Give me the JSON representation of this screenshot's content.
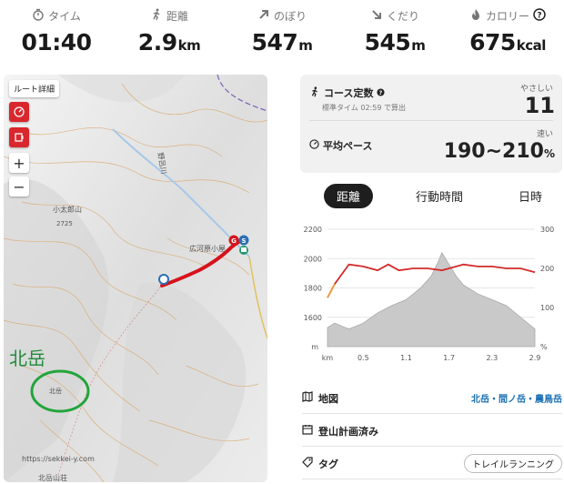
{
  "stats": [
    {
      "icon": "stopwatch-icon",
      "label": "タイム",
      "value": "01:40",
      "unit": ""
    },
    {
      "icon": "hiker-icon",
      "label": "距離",
      "value": "2.9",
      "unit": "km"
    },
    {
      "icon": "arrow-up-right-icon",
      "label": "のぼり",
      "value": "547",
      "unit": "m"
    },
    {
      "icon": "arrow-down-right-icon",
      "label": "くだり",
      "value": "545",
      "unit": "m"
    },
    {
      "icon": "flame-icon",
      "label": "カロリー",
      "value": "675",
      "unit": "kcal"
    }
  ],
  "map": {
    "route_detail_label": "ルート詳細",
    "zoom_in": "+",
    "zoom_out": "−",
    "labels": {
      "hut": "広河原小屋",
      "peak1": "小太郎山",
      "peak1_elev": "2725",
      "kitadake_map": "北岳",
      "kitadake_hut": "北岳山荘",
      "river": "野呂川"
    },
    "annotation": "北岳",
    "copyright": "https://sekkei-y.com",
    "markers": {
      "goal": "G",
      "start": "S",
      "bus": "B"
    }
  },
  "course": {
    "title": "コース定数",
    "standard_time": "標準タイム 02:59 で算出",
    "easy_label": "やさしい",
    "constant": "11",
    "pace_title": "平均ペース",
    "fast_label": "速い",
    "pace_value": "190~210",
    "pace_unit": "%"
  },
  "tabs": [
    {
      "label": "距離",
      "active": true
    },
    {
      "label": "行動時間",
      "active": false
    },
    {
      "label": "日時",
      "active": false
    }
  ],
  "chart_data": {
    "type": "area",
    "x_unit": "km",
    "left_unit": "m",
    "right_unit": "%",
    "x_ticks": [
      "0.5",
      "1.1",
      "1.7",
      "2.3",
      "2.9"
    ],
    "left_ticks": [
      "2200",
      "2000",
      "1800",
      "1600"
    ],
    "right_ticks": [
      "300",
      "200",
      "100",
      ""
    ],
    "xlim": [
      0,
      2.9
    ],
    "ylim_left": [
      1400,
      2200
    ],
    "ylim_right": [
      0,
      300
    ],
    "elevation": {
      "name": "elevation",
      "x": [
        0,
        0.1,
        0.3,
        0.5,
        0.7,
        0.9,
        1.1,
        1.3,
        1.45,
        1.55,
        1.6,
        1.7,
        1.8,
        1.9,
        2.1,
        2.3,
        2.5,
        2.7,
        2.9
      ],
      "y": [
        1530,
        1560,
        1520,
        1560,
        1630,
        1680,
        1720,
        1800,
        1880,
        1980,
        2040,
        1960,
        1880,
        1820,
        1760,
        1720,
        1680,
        1600,
        1520
      ]
    },
    "pace": {
      "name": "pace",
      "x": [
        0,
        0.1,
        0.3,
        0.5,
        0.7,
        0.85,
        1.0,
        1.2,
        1.4,
        1.6,
        1.8,
        1.9,
        2.1,
        2.3,
        2.5,
        2.7,
        2.9
      ],
      "y": [
        125,
        160,
        210,
        205,
        195,
        210,
        195,
        200,
        200,
        195,
        205,
        210,
        205,
        205,
        200,
        200,
        190
      ]
    },
    "colors": {
      "elevation_fill": "#c9c9c9",
      "pace_line": "#d42a2a",
      "start_segment": "#e9a23b"
    }
  },
  "info": {
    "map_label": "地図",
    "map_value": "北岳・間ノ岳・農鳥岳",
    "plan_label": "登山計画済み",
    "tag_label": "タグ",
    "tag_value": "トレイルランニング"
  },
  "colors": {
    "accent_red": "#d9272e",
    "route_red": "#d6131c",
    "annotation_green": "#22a53b",
    "link_blue": "#1a6fb3"
  }
}
